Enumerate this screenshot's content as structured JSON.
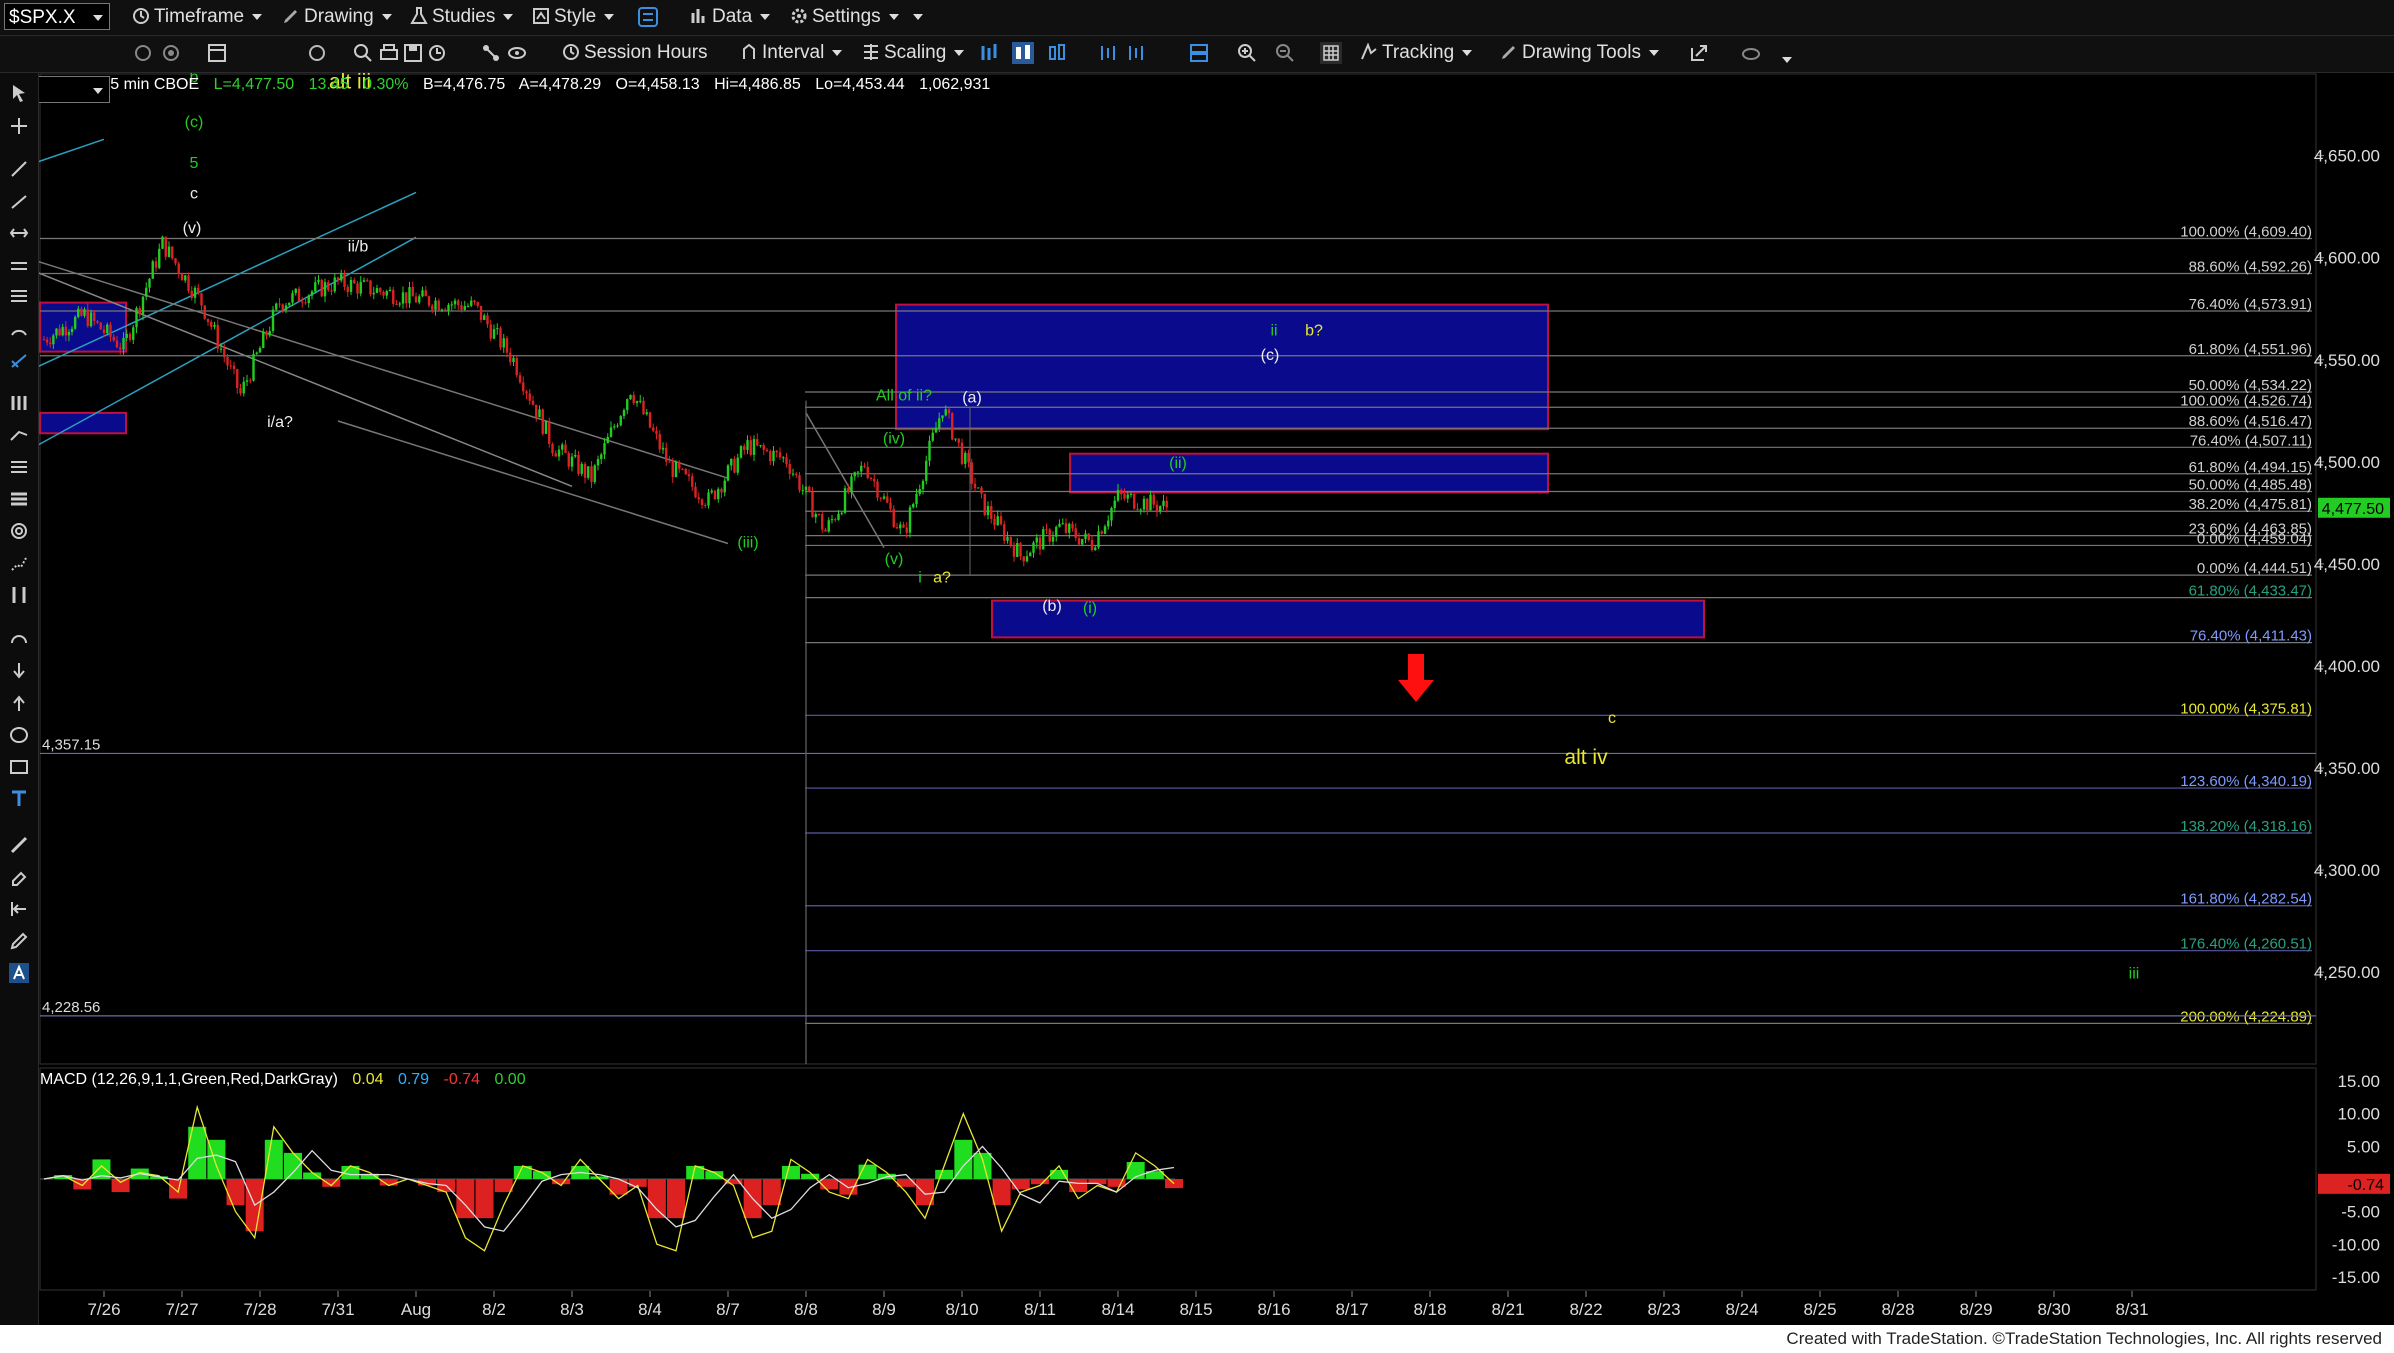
{
  "toolbar": {
    "symbol": "$SPX.X",
    "timeframe_label": "Timeframe",
    "drawing_label": "Drawing",
    "studies_label": "Studies",
    "style_label": "Style",
    "data_label": "Data",
    "settings_label": "Settings",
    "session_hours_label": "Session Hours",
    "interval_label": "Interval",
    "scaling_label": "Scaling",
    "tracking_label": "Tracking",
    "drawing_tools_label": "Drawing Tools"
  },
  "header": {
    "symbol_info": "$SPX.X - 5 min  CBOE",
    "last": "L=4,477.50",
    "change": "13.45",
    "change_pct": "0.30%",
    "bid": "B=4,476.75",
    "ask": "A=4,478.29",
    "open": "O=4,458.13",
    "high": "Hi=4,486.85",
    "low": "Lo=4,453.44",
    "volume": "1,062,931"
  },
  "colors": {
    "background": "#000000",
    "up_candle": "#22cc22",
    "down_candle": "#dd2222",
    "box_fill": "#0a0a8c",
    "box_border": "#c01040",
    "fib_text": "#d0d0d0",
    "green_label": "#22cc22",
    "yellow_label": "#e8e830",
    "arrow": "#ff1010"
  },
  "footer": {
    "credit": "Created with TradeStation. ©TradeStation Technologies, Inc. All rights reserved"
  },
  "chart_data": {
    "type": "candlestick",
    "symbol": "$SPX.X",
    "interval": "5 min",
    "ylim": [
      4205,
      4690
    ],
    "y_ticks": [
      4650,
      4600,
      4550,
      4500,
      4450,
      4400,
      4350,
      4300,
      4250
    ],
    "y_tick_labels": [
      "4,650.00",
      "4,600.00",
      "4,550.00",
      "4,500.00",
      "4,450.00",
      "4,400.00",
      "4,350.00",
      "4,300.00",
      "4,250.00"
    ],
    "last_price_label": "4,477.50",
    "x_labels": [
      "7/26",
      "7/27",
      "7/28",
      "7/31",
      "Aug",
      "8/2",
      "8/3",
      "8/4",
      "8/7",
      "8/8",
      "8/9",
      "8/10",
      "8/11",
      "8/14",
      "8/15",
      "8/16",
      "8/17",
      "8/18",
      "8/21",
      "8/22",
      "8/23",
      "8/24",
      "8/25",
      "8/28",
      "8/29",
      "8/30",
      "8/31"
    ],
    "price_path": [
      {
        "date": "7/25",
        "close": 4560
      },
      {
        "date": "7/26",
        "close": 4572
      },
      {
        "date": "7/26",
        "close": 4556
      },
      {
        "date": "7/27",
        "close": 4607
      },
      {
        "date": "7/27",
        "close": 4578
      },
      {
        "date": "7/28",
        "close": 4533
      },
      {
        "date": "7/28",
        "close": 4578
      },
      {
        "date": "7/31",
        "close": 4588
      },
      {
        "date": "Aug",
        "close": 4580
      },
      {
        "date": "8/2",
        "close": 4576
      },
      {
        "date": "8/2",
        "close": 4550
      },
      {
        "date": "8/3",
        "close": 4508
      },
      {
        "date": "8/3",
        "close": 4492
      },
      {
        "date": "8/4",
        "close": 4536
      },
      {
        "date": "8/4",
        "close": 4498
      },
      {
        "date": "8/7",
        "close": 4481
      },
      {
        "date": "8/7",
        "close": 4508
      },
      {
        "date": "8/8",
        "close": 4501
      },
      {
        "date": "8/8",
        "close": 4466
      },
      {
        "date": "8/9",
        "close": 4499
      },
      {
        "date": "8/9",
        "close": 4464
      },
      {
        "date": "8/10",
        "close": 4527
      },
      {
        "date": "8/10",
        "close": 4480
      },
      {
        "date": "8/11",
        "close": 4454
      },
      {
        "date": "8/11",
        "close": 4468
      },
      {
        "date": "8/14",
        "close": 4460
      },
      {
        "date": "8/14",
        "close": 4483
      },
      {
        "date": "8/14",
        "close": 4477.5
      }
    ],
    "fib_levels": [
      {
        "label": "100.00% (4,609.40)",
        "value": 4609.4
      },
      {
        "label": "88.60% (4,592.26)",
        "value": 4592.26
      },
      {
        "label": "76.40% (4,573.91)",
        "value": 4573.91
      },
      {
        "label": "61.80% (4,551.96)",
        "value": 4551.96
      },
      {
        "label": "50.00% (4,534.22)",
        "value": 4534.22
      },
      {
        "label": "100.00% (4,526.74)",
        "value": 4526.74
      },
      {
        "label": "88.60% (4,516.47)",
        "value": 4516.47
      },
      {
        "label": "76.40% (4,507.11)",
        "value": 4507.11
      },
      {
        "label": "61.80% (4,494.15)",
        "value": 4494.15
      },
      {
        "label": "50.00% (4,485.48)",
        "value": 4485.48
      },
      {
        "label": "38.20% (4,475.81)",
        "value": 4475.81
      },
      {
        "label": "23.60% (4,463.85)",
        "value": 4463.85
      },
      {
        "label": "0.00% (4,459.04)",
        "value": 4459.04
      },
      {
        "label": "0.00% (4,444.51)",
        "value": 4444.51
      },
      {
        "label": "61.80% (4,433.47)",
        "value": 4433.47
      },
      {
        "label": "76.40% (4,411.43)",
        "value": 4411.43
      },
      {
        "label": "100.00% (4,375.81)",
        "value": 4375.81
      },
      {
        "label": "123.60% (4,340.19)",
        "value": 4340.19
      },
      {
        "label": "138.20% (4,318.16)",
        "value": 4318.16
      },
      {
        "label": "161.80% (4,282.54)",
        "value": 4282.54
      },
      {
        "label": "176.40% (4,260.51)",
        "value": 4260.51
      },
      {
        "label": "200.00% (4,224.89)",
        "value": 4224.89
      }
    ],
    "horizontal_levels": [
      {
        "label": "4,357.15",
        "value": 4357.15
      },
      {
        "label": "4,228.56",
        "value": 4228.56
      }
    ],
    "zones": [
      {
        "name": "upper-target-box",
        "from": "8/9",
        "to": "8/21",
        "low": 4516,
        "high": 4577
      },
      {
        "name": "small-left-box-1",
        "from": "7/25",
        "to": "7/26",
        "low": 4554,
        "high": 4578
      },
      {
        "name": "small-left-box-2",
        "from": "7/25",
        "to": "7/26",
        "low": 4514,
        "high": 4524
      },
      {
        "name": "ii-box",
        "from": "8/11",
        "to": "8/21",
        "low": 4485,
        "high": 4504
      },
      {
        "name": "support-box",
        "from": "8/10",
        "to": "8/23",
        "low": 4414,
        "high": 4432
      }
    ],
    "wave_labels": [
      {
        "text": "b",
        "date": "7/27",
        "price": 4686,
        "color": "green"
      },
      {
        "text": "alt iii",
        "date": "7/28",
        "price": 4683,
        "color": "yellow"
      },
      {
        "text": "(c)",
        "date": "7/27",
        "price": 4664,
        "color": "green"
      },
      {
        "text": "5",
        "date": "7/27",
        "price": 4644,
        "color": "green"
      },
      {
        "text": "c",
        "date": "7/27",
        "price": 4629,
        "color": "white"
      },
      {
        "text": "(v)",
        "date": "7/27",
        "price": 4612,
        "color": "white"
      },
      {
        "text": "ii/b",
        "date": "7/31",
        "price": 4603,
        "color": "white"
      },
      {
        "text": "i/a?",
        "date": "7/28",
        "price": 4517,
        "color": "white"
      },
      {
        "text": "All of ii?",
        "date": "8/9",
        "price": 4530,
        "color": "green"
      },
      {
        "text": "(a)",
        "date": "8/10",
        "price": 4529,
        "color": "white"
      },
      {
        "text": "(iv)",
        "date": "8/9",
        "price": 4509,
        "color": "green"
      },
      {
        "text": "(iii)",
        "date": "8/7",
        "price": 4458,
        "color": "green"
      },
      {
        "text": "(v)",
        "date": "8/9",
        "price": 4450,
        "color": "green"
      },
      {
        "text": "i",
        "date": "8/9",
        "price": 4441,
        "color": "green"
      },
      {
        "text": "a?",
        "date": "8/9",
        "price": 4441,
        "color": "yellow"
      },
      {
        "text": "(b)",
        "date": "8/11",
        "price": 4427,
        "color": "white"
      },
      {
        "text": "(i)",
        "date": "8/11",
        "price": 4426,
        "color": "green"
      },
      {
        "text": "(ii)",
        "date": "8/14",
        "price": 4497,
        "color": "green"
      },
      {
        "text": "ii",
        "date": "8/16",
        "price": 4562,
        "color": "green"
      },
      {
        "text": "b?",
        "date": "8/16",
        "price": 4562,
        "color": "yellow"
      },
      {
        "text": "(c)",
        "date": "8/16",
        "price": 4550,
        "color": "white"
      },
      {
        "text": "c",
        "date": "8/22",
        "price": 4372,
        "color": "yellow"
      },
      {
        "text": "alt iv",
        "date": "8/22",
        "price": 4352,
        "color": "yellow"
      },
      {
        "text": "iii",
        "date": "8/30",
        "price": 4247,
        "color": "green"
      }
    ],
    "macd": {
      "title": "MACD (12,26,9,1,1,Green,Red,DarkGray)",
      "values": [
        "0.04",
        "0.79",
        "-0.74",
        "0.00"
      ],
      "ylim": [
        -17,
        17
      ],
      "y_tick_labels": [
        "15.00",
        "10.00",
        "5.00",
        "-5.00",
        "-10.00",
        "-15.00"
      ],
      "last_label": "-0.74",
      "macd_path": [
        0,
        0.5,
        -1,
        2,
        -0.5,
        1,
        0.5,
        -2,
        11,
        2,
        -5,
        -9,
        8,
        4,
        1,
        -1,
        2,
        1,
        -1,
        0,
        -1,
        -2,
        -9,
        -11,
        -4,
        2,
        1,
        -1,
        3,
        0,
        -3,
        -1,
        -10,
        -11,
        2,
        1,
        -1,
        -9,
        -8,
        3,
        1,
        -2,
        -3,
        3,
        1,
        -2,
        -6,
        2,
        10,
        3,
        -8,
        -2,
        -1,
        2,
        -3,
        -1,
        -2,
        4,
        2,
        -0.7
      ],
      "histogram_path": [
        0,
        0.3,
        -0.8,
        1.5,
        -1,
        0.8,
        0.2,
        -1.5,
        4,
        3,
        -2,
        -4,
        3,
        2,
        0.5,
        -0.6,
        1,
        0.4,
        -0.5,
        0,
        -0.5,
        -1,
        -3,
        -3,
        -1,
        1,
        0.6,
        -0.4,
        1,
        0.2,
        -1.2,
        -0.6,
        -3,
        -3,
        1,
        0.6,
        -0.4,
        -3,
        -2,
        1,
        0.4,
        -0.8,
        -1.2,
        1.1,
        0.4,
        -0.6,
        -2,
        0.7,
        3,
        2,
        -2,
        -0.8,
        -0.4,
        0.7,
        -1,
        -0.4,
        -0.6,
        1.3,
        0.6,
        -0.7
      ]
    }
  }
}
